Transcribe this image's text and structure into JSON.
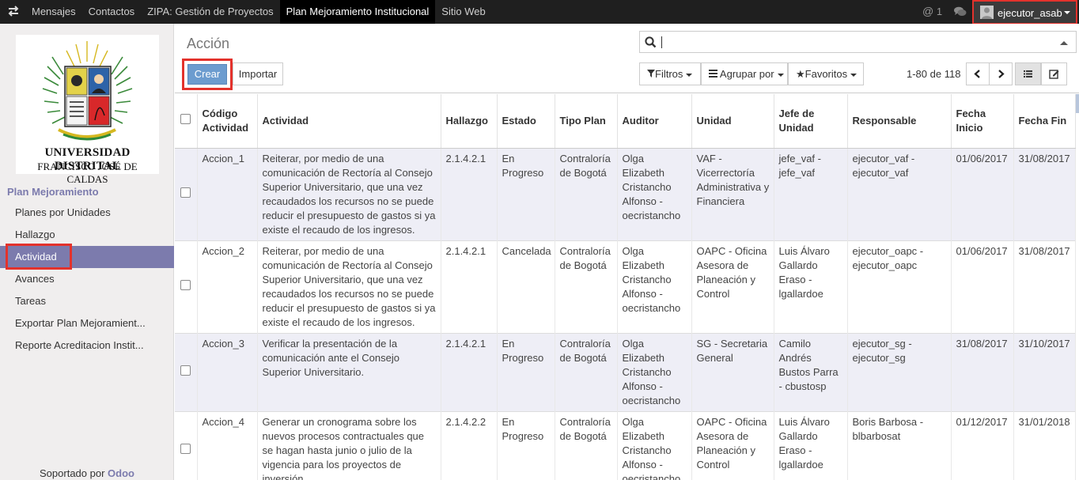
{
  "topbar": {
    "menu": [
      {
        "label": "Mensajes"
      },
      {
        "label": "Contactos"
      },
      {
        "label": "ZIPA: Gestión de Proyectos"
      },
      {
        "label": "Plan Mejoramiento Institucional",
        "active": true
      },
      {
        "label": "Sitio Web"
      }
    ],
    "mention_count": "1",
    "user": "ejecutor_asab",
    "icons": [
      "toggle-arrows-icon",
      "at-sign-icon",
      "chat-bubble-icon",
      "avatar-icon"
    ]
  },
  "sidebar": {
    "logo": {
      "line1": "UNIVERSIDAD DISTRITAL",
      "line2": "FRANCISCO JOSÉ DE CALDAS"
    },
    "section": "Plan Mejoramiento",
    "items": [
      {
        "label": "Planes por Unidades"
      },
      {
        "label": "Hallazgo"
      },
      {
        "label": "Actividad",
        "active": true
      },
      {
        "label": "Avances"
      },
      {
        "label": "Tareas"
      },
      {
        "label": "Exportar Plan Mejoramient..."
      },
      {
        "label": "Reporte Acreditacion Instit..."
      }
    ],
    "powered_prefix": "Soportado por",
    "powered_brand": "Odoo"
  },
  "control_panel": {
    "title": "Acción",
    "search_value": "",
    "buttons": {
      "create": "Crear",
      "import": "Importar"
    },
    "filters": "Filtros",
    "group_by": "Agrupar por",
    "favorites": "Favoritos",
    "pager": "1-80 de 118",
    "view": "list"
  },
  "table": {
    "headers": [
      "Código Actividad",
      "Actividad",
      "Hallazgo",
      "Estado",
      "Tipo Plan",
      "Auditor",
      "Unidad",
      "Jefe de Unidad",
      "Responsable",
      "Fecha Inicio",
      "Fecha Fin"
    ],
    "rows": [
      {
        "codigo": "Accion_1",
        "actividad": "Reiterar, por medio de una comunicación de Rectoría al Consejo Superior Universitario, que una vez recaudados los recursos no se puede reducir el presupuesto de gastos si ya existe el recaudo de los ingresos.",
        "hallazgo": "2.1.4.2.1",
        "estado": "En Progreso",
        "tipo_plan": "Contraloría de Bogotá",
        "auditor": "Olga Elizabeth Cristancho Alfonso - oecristancho",
        "unidad": "VAF - Vicerrectoría Administrativa y Financiera",
        "jefe": "jefe_vaf - jefe_vaf",
        "responsable": "ejecutor_vaf - ejecutor_vaf",
        "inicio": "01/06/2017",
        "fin": "31/08/2017"
      },
      {
        "codigo": "Accion_2",
        "actividad": "Reiterar, por medio de una comunicación de Rectoría al Consejo Superior Universitario, que una vez recaudados los recursos no se puede reducir el presupuesto de gastos si ya existe el recaudo de los ingresos.",
        "hallazgo": "2.1.4.2.1",
        "estado": "Cancelada",
        "tipo_plan": "Contraloría de Bogotá",
        "auditor": "Olga Elizabeth Cristancho Alfonso - oecristancho",
        "unidad": "OAPC - Oficina Asesora de Planeación y Control",
        "jefe": "Luis Álvaro Gallardo Eraso - lgallardoe",
        "responsable": "ejecutor_oapc - ejecutor_oapc",
        "inicio": "01/06/2017",
        "fin": "31/08/2017"
      },
      {
        "codigo": "Accion_3",
        "actividad": "Verificar la presentación de la comunicación ante el Consejo Superior Universitario.",
        "hallazgo": "2.1.4.2.1",
        "estado": "En Progreso",
        "tipo_plan": "Contraloría de Bogotá",
        "auditor": "Olga Elizabeth Cristancho Alfonso - oecristancho",
        "unidad": "SG - Secretaria General",
        "jefe": "Camilo Andrés Bustos Parra - cbustosp",
        "responsable": "ejecutor_sg - ejecutor_sg",
        "inicio": "31/08/2017",
        "fin": "31/10/2017"
      },
      {
        "codigo": "Accion_4",
        "actividad": "Generar un cronograma sobre los nuevos procesos contractuales que se hagan hasta junio o julio de la vigencia para los proyectos de inversión.",
        "hallazgo": "2.1.4.2.2",
        "estado": "En Progreso",
        "tipo_plan": "Contraloría de Bogotá",
        "auditor": "Olga Elizabeth Cristancho Alfonso - oecristancho",
        "unidad": "OAPC - Oficina Asesora de Planeación y Control",
        "jefe": "Luis Álvaro Gallardo Eraso - lgallardoe",
        "responsable": "Boris Barbosa - blbarbosat",
        "inicio": "01/12/2017",
        "fin": "31/01/2018"
      }
    ]
  }
}
